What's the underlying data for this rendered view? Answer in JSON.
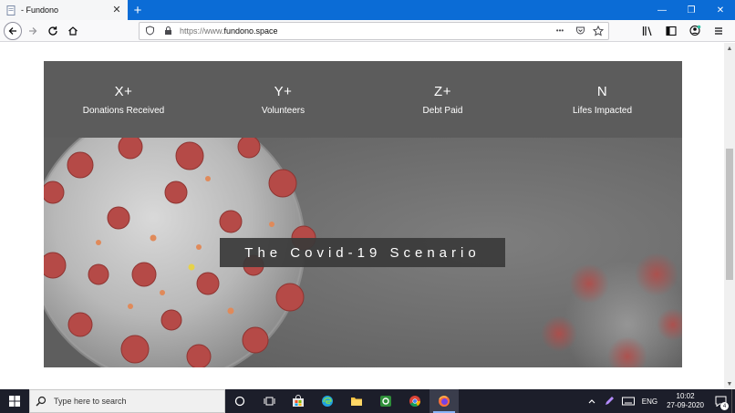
{
  "browser": {
    "tab": {
      "title": "- Fundono",
      "favicon_icon": "page-icon",
      "close_glyph": "✕"
    },
    "new_tab_glyph": "+",
    "window_controls": {
      "minimize": "—",
      "maximize": "❐",
      "close": "✕"
    },
    "url": {
      "prefix": "https://www.",
      "domain": "fundono.space"
    },
    "url_actions_glyph": "•••"
  },
  "page": {
    "stats": [
      {
        "value": "X+",
        "label": "Donations Received"
      },
      {
        "value": "Y+",
        "label": "Volunteers"
      },
      {
        "value": "Z+",
        "label": "Debt Paid"
      },
      {
        "value": "N",
        "label": "Lifes Impacted"
      }
    ],
    "hero": {
      "caption": "The Covid-19 Scenario",
      "image_icon": "coronavirus-image"
    }
  },
  "taskbar": {
    "search_placeholder": "Type here to search",
    "language": "ENG",
    "time": "10:02",
    "date": "27-09-2020",
    "notification_count": "4"
  },
  "colors": {
    "titlebar": "#0b6cd6",
    "stats_bg": "#5c5c5c",
    "taskbar_bg": "#1c1e2a",
    "virus_red": "#b54a47"
  }
}
